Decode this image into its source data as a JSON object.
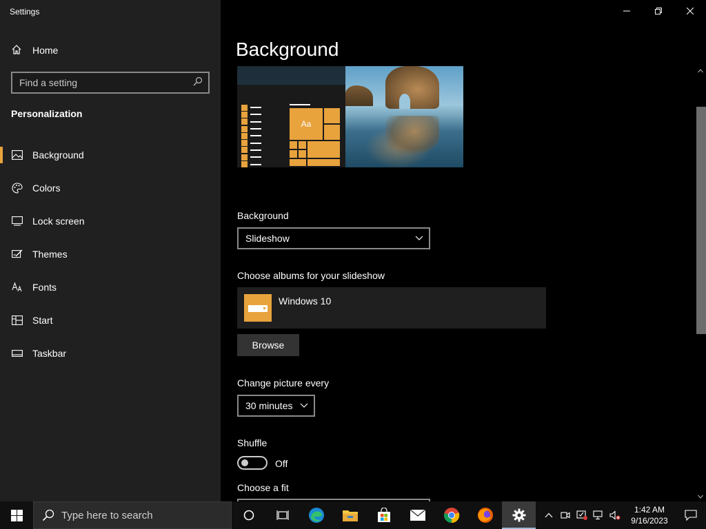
{
  "window": {
    "app_title": "Settings"
  },
  "sidebar": {
    "home_label": "Home",
    "search_placeholder": "Find a setting",
    "section_title": "Personalization",
    "items": [
      {
        "label": "Background",
        "icon": "picture-icon",
        "active": true
      },
      {
        "label": "Colors",
        "icon": "palette-icon"
      },
      {
        "label": "Lock screen",
        "icon": "lock-screen-icon"
      },
      {
        "label": "Themes",
        "icon": "themes-brush-icon"
      },
      {
        "label": "Fonts",
        "icon": "fonts-icon"
      },
      {
        "label": "Start",
        "icon": "start-tiles-icon"
      },
      {
        "label": "Taskbar",
        "icon": "taskbar-icon"
      }
    ]
  },
  "main": {
    "page_title": "Background",
    "preview_tile_text": "Aa",
    "background_label": "Background",
    "background_value": "Slideshow",
    "albums_label": "Choose albums for your slideshow",
    "album_name": "Windows 10",
    "browse_label": "Browse",
    "change_picture_label": "Change picture every",
    "change_picture_value": "30 minutes",
    "shuffle_label": "Shuffle",
    "shuffle_state": "Off",
    "fit_label": "Choose a fit"
  },
  "taskbar": {
    "search_placeholder": "Type here to search",
    "pinned_apps": [
      "cortana-icon",
      "task-view-icon",
      "edge-icon",
      "file-explorer-icon",
      "store-icon",
      "mail-icon",
      "chrome-icon",
      "firefox-icon",
      "settings-icon"
    ],
    "clock_time": "1:42 AM",
    "clock_date": "9/16/2023"
  },
  "colors": {
    "accent": "#e8a33d",
    "sidebar_bg": "#202020",
    "main_bg": "#000000"
  }
}
